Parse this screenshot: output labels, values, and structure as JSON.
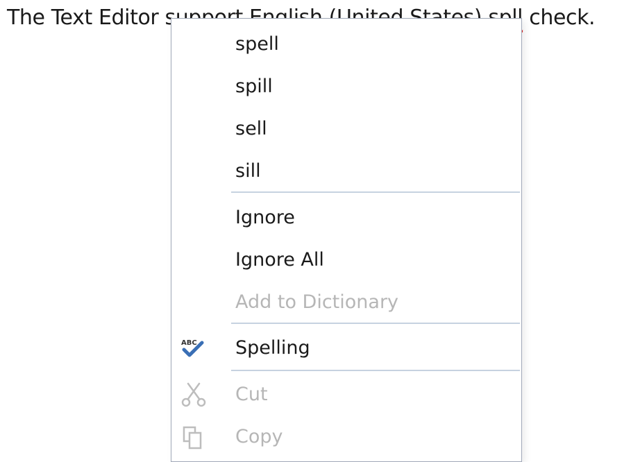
{
  "editor": {
    "text_before": "The Text Editor support English (United States) ",
    "misspelled_word": "spll",
    "text_after": " check."
  },
  "context_menu": {
    "suggestions": [
      "spell",
      "spill",
      "sell",
      "sill"
    ],
    "ignore_label": "Ignore",
    "ignore_all_label": "Ignore All",
    "add_to_dictionary_label": "Add to Dictionary",
    "spelling_label": "Spelling",
    "spelling_icon_text": "ABC",
    "cut_label": "Cut",
    "copy_label": "Copy"
  },
  "colors": {
    "menu_border": "#a0a8b8",
    "separator": "#c6d2e0",
    "disabled_text": "#b6b6b6",
    "check_icon": "#3a6fb5",
    "squiggle": "#e02020"
  },
  "icons": {
    "spelling": "abc-check-icon",
    "cut": "scissors-icon",
    "copy": "copy-icon"
  }
}
